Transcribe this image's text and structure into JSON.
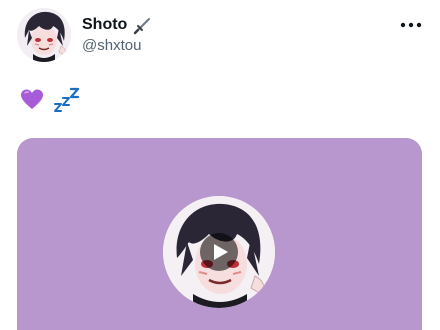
{
  "post": {
    "display_name": "Shoto",
    "handle": "@shxtou",
    "name_emoji": "dagger",
    "text_emojis": [
      "purple-heart",
      "zzz"
    ],
    "more_icon": "more-horizontal-icon"
  },
  "media": {
    "type": "video",
    "background_color": "#b797cd",
    "play_icon": "play-icon"
  },
  "colors": {
    "text_primary": "#0f1419",
    "text_secondary": "#536471",
    "purple_heart": "#a65bd9",
    "zzz_blue": "#1b6ec2"
  }
}
